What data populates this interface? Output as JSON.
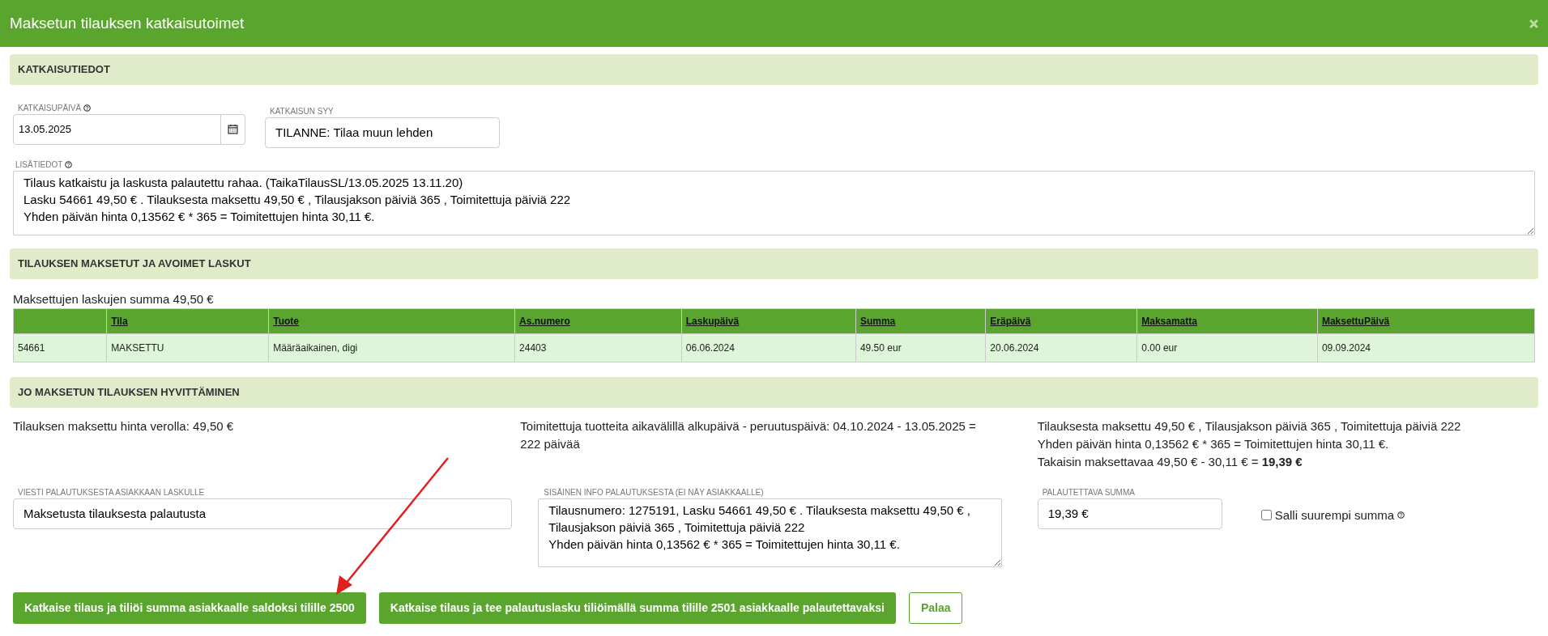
{
  "dialog": {
    "title": "Maksetun tilauksen katkaisutoimet"
  },
  "details": {
    "heading": "KATKAISUTIEDOT",
    "date_field": {
      "label": "KATKAISUPÄIVÄ",
      "value": "13.05.2025"
    },
    "reason_field": {
      "label": "KATKAISUN SYY",
      "value": "TILANNE: Tilaa muun lehden"
    },
    "notes_field": {
      "label": "LISÄTIEDOT",
      "lines": [
        "Tilaus katkaistu ja laskusta palautettu rahaa. (TaikaTilausSL/13.05.2025 13.11.20)",
        "Lasku 54661 49,50 € . Tilauksesta maksettu 49,50 € , Tilausjakson päiviä 365 , Toimitettuja päiviä 222",
        "Yhden päivän hinta 0,13562 € * 365 = Toimitettujen hinta 30,11 €."
      ]
    }
  },
  "invoices": {
    "heading": "TILAUKSEN MAKSETUT JA AVOIMET LASKUT",
    "sum_text": "Maksettujen laskujen summa 49,50 €",
    "table": {
      "columns": [
        "",
        "Tila",
        "Tuote",
        "As.numero",
        "Laskupäivä",
        "Summa",
        "Eräpäivä",
        "Maksamatta",
        "MaksettuPäivä"
      ],
      "rows": [
        [
          "54661",
          "MAKSETTU",
          "Määräaikainen, digi",
          "24403",
          "06.06.2024",
          "49.50 eur",
          "20.06.2024",
          "0.00 eur",
          "09.09.2024"
        ]
      ]
    }
  },
  "refund": {
    "heading": "JO MAKSETUN TILAUKSEN HYVITTÄMINEN",
    "info": [
      [
        "Tilauksen maksettu hinta verolla: 49,50 €"
      ],
      [
        "Toimitettuja tuotteita aikavälillä alkupäivä - peruutuspäivä: 04.10.2024 - 13.05.2025 = 222 päivää"
      ],
      [
        "Tilauksesta maksettu 49,50 € , Tilausjakson päiviä 365 , Toimitettuja päiviä 222",
        "Yhden päivän hinta 0,13562 € * 365 = Toimitettujen hinta 30,11 €.",
        "Takaisin maksettavaa 49,50 € - 30,11 € = **19,39 €**"
      ]
    ],
    "message_field": {
      "label": "VIESTI PALAUTUKSESTA ASIAKKAAN LASKULLE",
      "value": "Maksetusta tilauksesta palautusta"
    },
    "internal_field": {
      "label": "SISÄINEN INFO PALAUTUKSESTA (EI NÄY ASIAKKAALLE)",
      "lines": [
        "Tilausnumero: 1275191, Lasku 54661 49,50 € . Tilauksesta maksettu 49,50 € , Tilausjakson päiviä 365 , Toimitettuja päiviä 222",
        "Yhden päivän hinta 0,13562 € * 365 = Toimitettujen hinta 30,11 €."
      ]
    },
    "amount_field": {
      "label": "PALAUTETTAVA SUMMA",
      "value": "19,39 €"
    },
    "allow_larger": {
      "label": "Salli suurempi summa",
      "checked": false
    }
  },
  "buttons": [
    {
      "label": "Katkaise tilaus ja tiliöi summa asiakkaalle saldoksi tilille 2500",
      "kind": "primary"
    },
    {
      "label": "Katkaise tilaus ja tee palautuslasku tiliöimällä summa tilille 2501 asiakkaalle palautettavaksi",
      "kind": "primary"
    },
    {
      "label": "Palaa",
      "kind": "outline"
    }
  ]
}
